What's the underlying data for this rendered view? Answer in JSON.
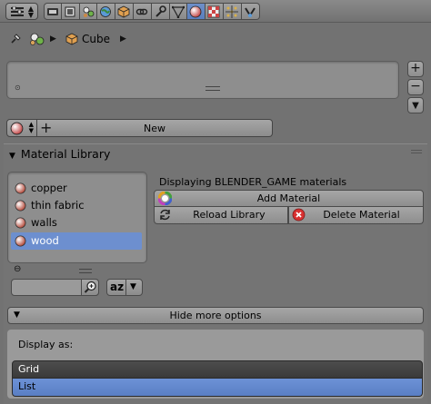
{
  "header": {
    "editor_type_icon": "properties-editor-icon",
    "tabs": [
      {
        "icon": "render-icon",
        "active": false
      },
      {
        "icon": "render-layers-icon",
        "active": false
      },
      {
        "icon": "scene-icon",
        "active": false
      },
      {
        "icon": "world-icon",
        "active": false
      },
      {
        "icon": "object-icon",
        "active": false
      },
      {
        "icon": "constraints-icon",
        "active": false
      },
      {
        "icon": "modifiers-icon",
        "active": false
      },
      {
        "icon": "data-icon",
        "active": false
      },
      {
        "icon": "material-icon",
        "active": true
      },
      {
        "icon": "texture-icon",
        "active": false
      },
      {
        "icon": "particles-icon",
        "active": false
      },
      {
        "icon": "physics-icon",
        "active": false
      }
    ]
  },
  "breadcrumb": {
    "object_name": "Cube"
  },
  "material_slot": {
    "new_label": "New"
  },
  "panel": {
    "title": "Material Library",
    "displaying_text": "Displaying BLENDER_GAME materials",
    "library_items": [
      {
        "label": "copper",
        "selected": false
      },
      {
        "label": "thin fabric",
        "selected": false
      },
      {
        "label": "walls",
        "selected": false
      },
      {
        "label": "wood",
        "selected": true
      }
    ],
    "search": {
      "value": ""
    },
    "sort_label": "az",
    "add_material_label": "Add Material",
    "reload_library_label": "Reload Library",
    "delete_material_label": "Delete Material",
    "hide_more_label": "Hide more options",
    "display_as_label": "Display as:",
    "display_options": [
      {
        "label": "Grid",
        "selected": false
      },
      {
        "label": "List",
        "selected": true
      }
    ]
  },
  "colors": {
    "background": "#727272",
    "selection_blue": "#6d8fcf",
    "active_tab_blue": "#5a7fbd"
  }
}
